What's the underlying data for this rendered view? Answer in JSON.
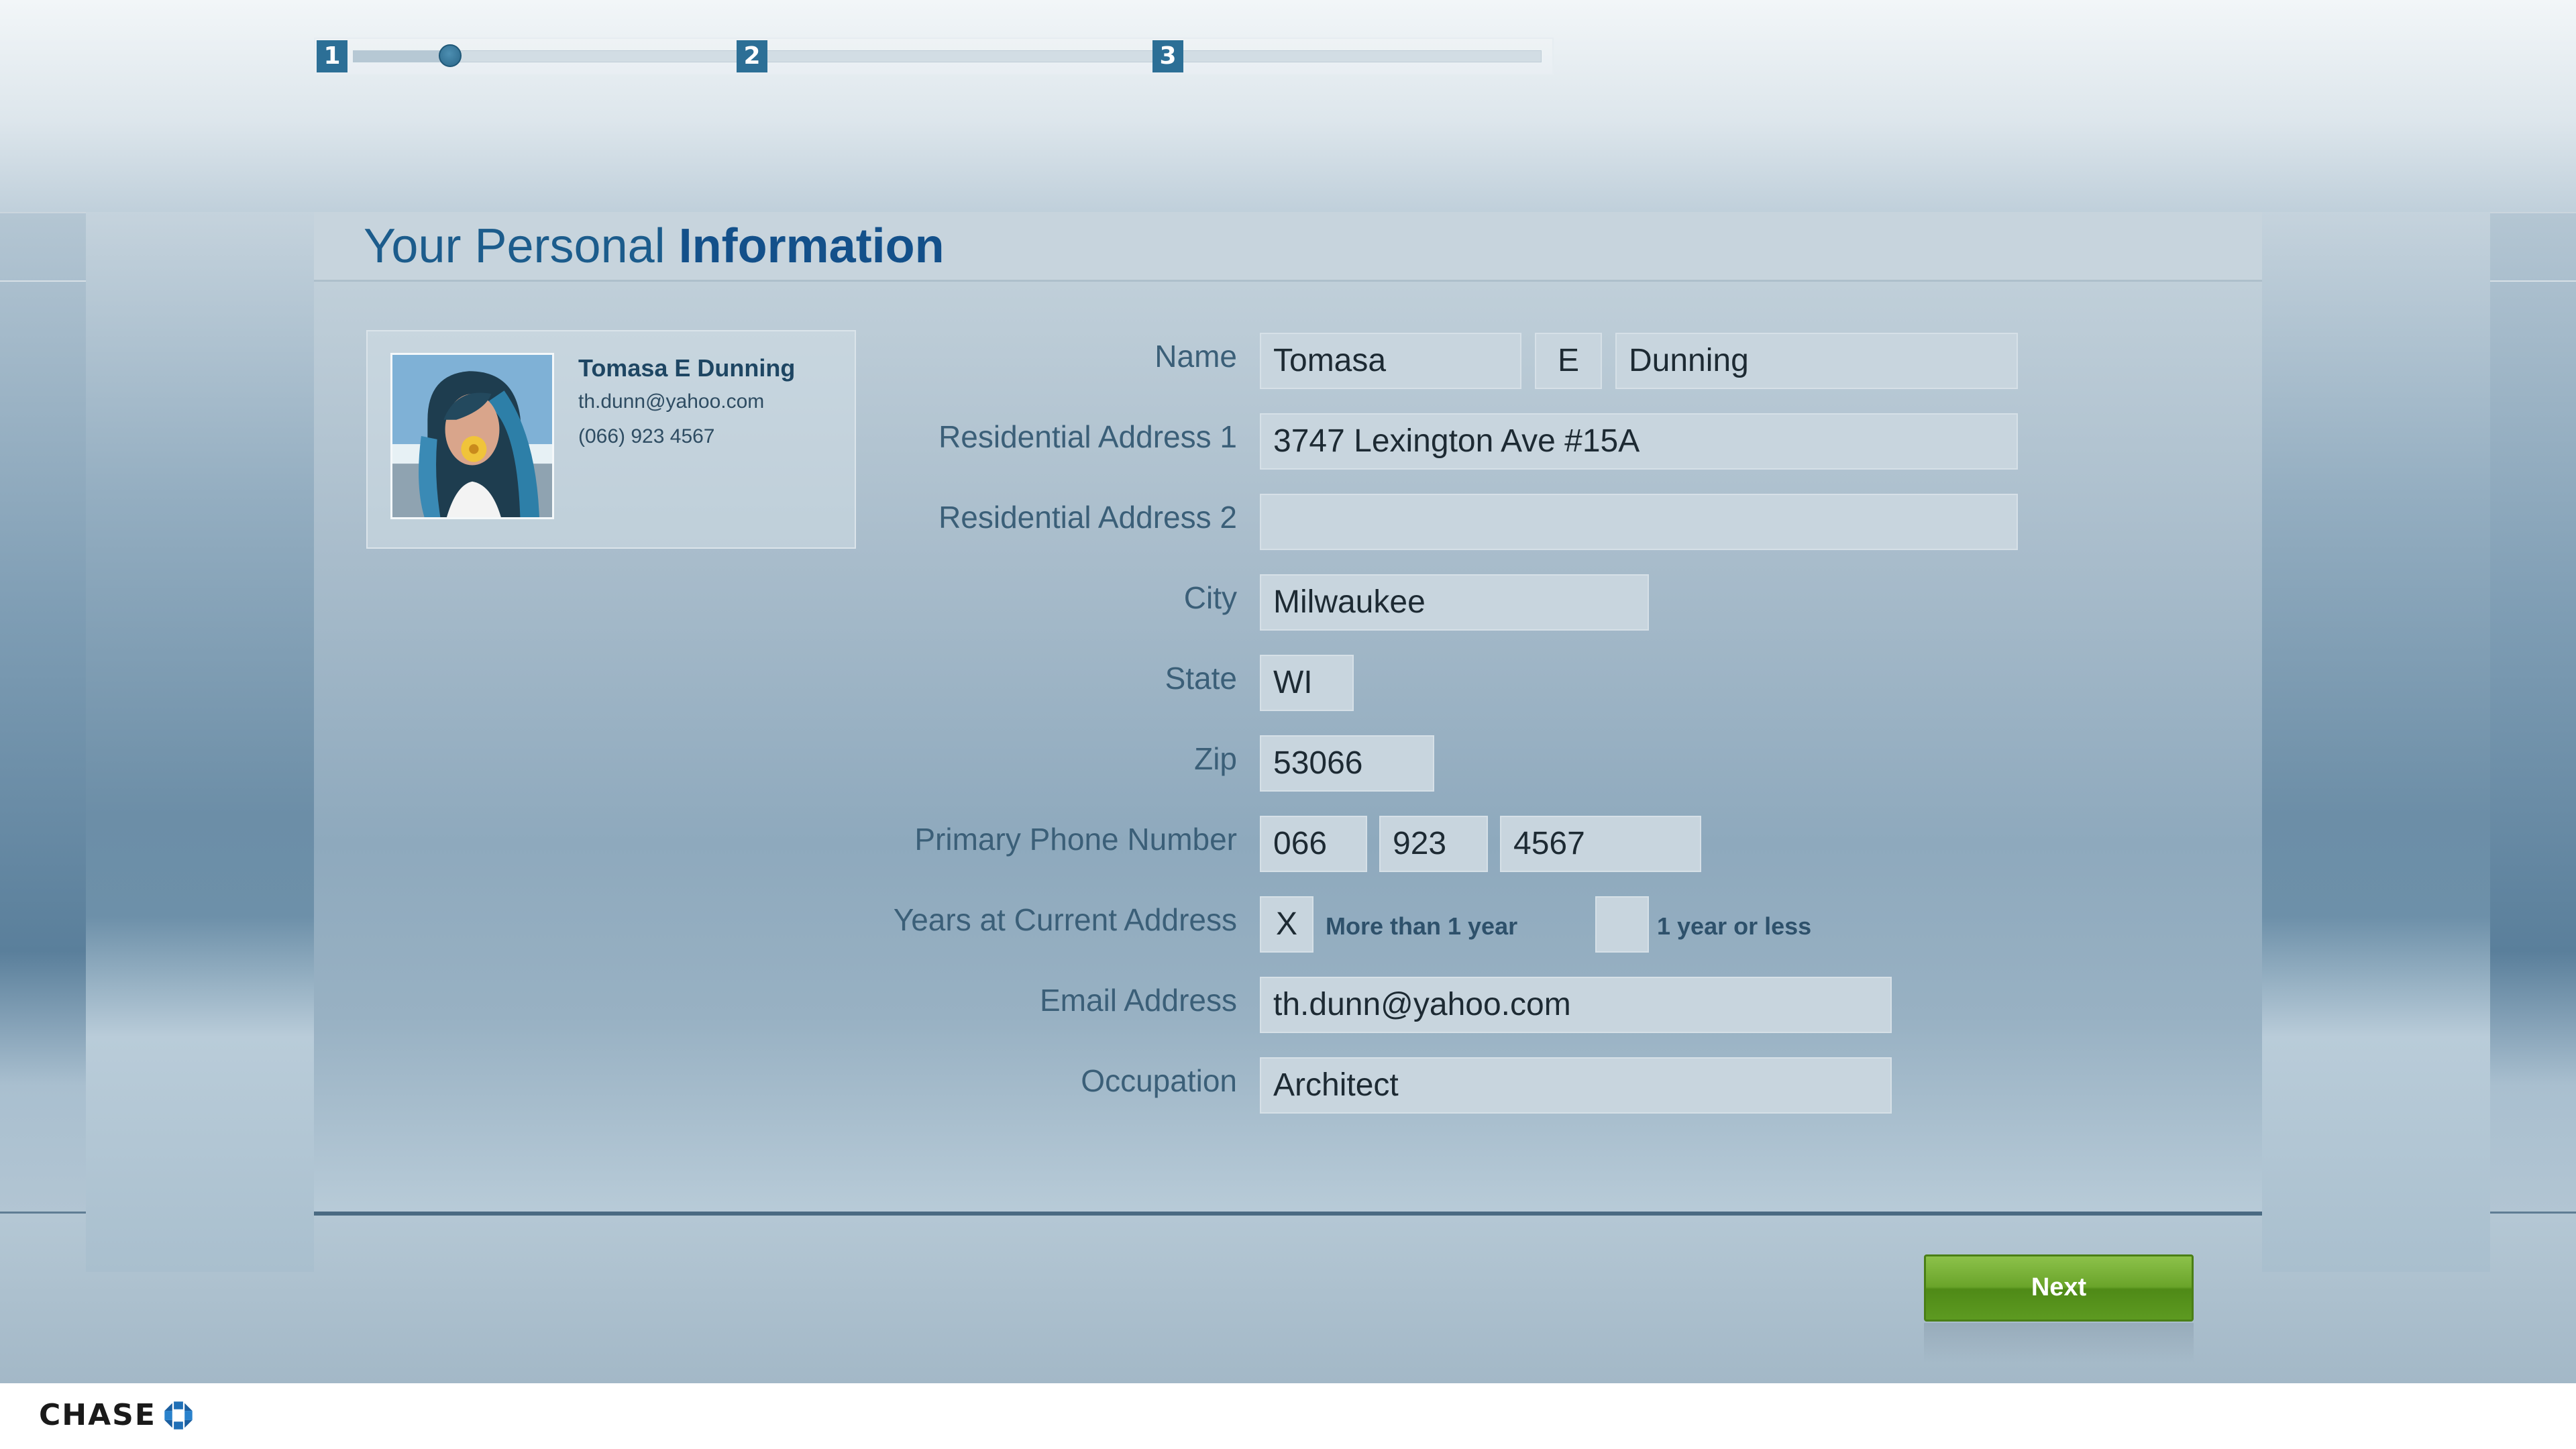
{
  "progress": {
    "steps": [
      "1",
      "2",
      "3"
    ],
    "current_step": 1
  },
  "panel": {
    "title_light": "Your Personal",
    "title_bold": "Information"
  },
  "profile": {
    "name": "Tomasa E Dunning",
    "email": "th.dunn@yahoo.com",
    "phone": "(066) 923 4567"
  },
  "form": {
    "name_label": "Name",
    "first_name": "Tomasa",
    "middle_initial": "E",
    "last_name": "Dunning",
    "address1_label": "Residential Address 1",
    "address1": "3747 Lexington Ave #15A",
    "address2_label": "Residential Address 2",
    "address2": "",
    "city_label": "City",
    "city": "Milwaukee",
    "state_label": "State",
    "state": "WI",
    "zip_label": "Zip",
    "zip": "53066",
    "phone_label": "Primary Phone Number",
    "phone_area": "066",
    "phone_prefix": "923",
    "phone_line": "4567",
    "years_label": "Years at Current Address",
    "years_more_mark": "X",
    "years_more_label": "More than 1 year",
    "years_less_mark": "",
    "years_less_label": "1 year or less",
    "email_label": "Email Address",
    "email": "th.dunn@yahoo.com",
    "occupation_label": "Occupation",
    "occupation": "Architect"
  },
  "actions": {
    "next_label": "Next"
  },
  "footer": {
    "brand": "CHASE"
  },
  "colors": {
    "accent": "#2c6f96",
    "title": "#1c5c8c",
    "next_button": "#6aa42a"
  }
}
